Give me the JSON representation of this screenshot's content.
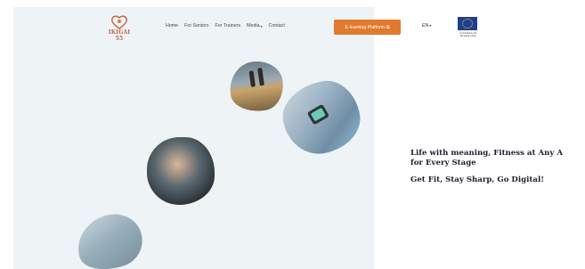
{
  "header": {
    "logo_text": "IKIGAI 55",
    "logo_sub": "",
    "nav": [
      {
        "label": "Home",
        "has_dropdown": false
      },
      {
        "label": "For Seniors",
        "has_dropdown": false
      },
      {
        "label": "For Trainers",
        "has_dropdown": false
      },
      {
        "label": "Media",
        "has_dropdown": true
      },
      {
        "label": "Contact",
        "has_dropdown": false
      }
    ],
    "cta_label": "E-learning Platform",
    "language": "EN",
    "eu_caption": "Co-funded by the European Union"
  },
  "hero": {
    "tagline_line1": "Life with meaning, Fitness at Any A",
    "tagline_line2": "for Every Stage",
    "tagline_line3": "Get Fit, Stay Sharp, Go Digital!"
  },
  "colors": {
    "accent": "#e07a2e",
    "panel": "#eef3f6",
    "eu_blue": "#1f3e93"
  }
}
